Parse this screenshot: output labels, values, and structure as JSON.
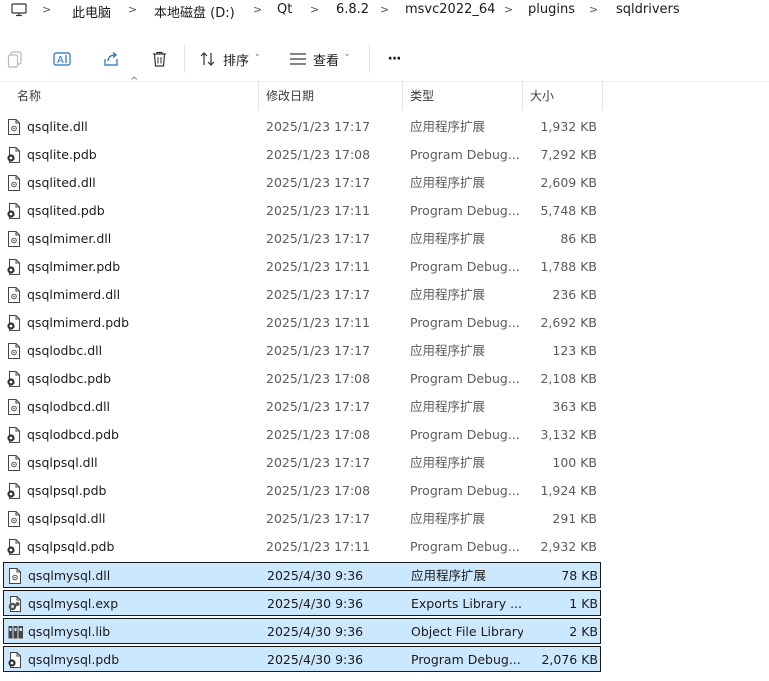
{
  "breadcrumb": [
    "此电脑",
    "本地磁盘 (D:)",
    "Qt",
    "6.8.2",
    "msvc2022_64",
    "plugins",
    "sqldrivers"
  ],
  "toolbar": {
    "sort_label": "排序",
    "view_label": "查看",
    "more_label": "···"
  },
  "columns": {
    "name": "名称",
    "date": "修改日期",
    "type": "类型",
    "size": "大小"
  },
  "files": [
    {
      "name": "qsqlite.dll",
      "date": "2025/1/23 17:17",
      "type": "应用程序扩展",
      "size": "1,932 KB",
      "icon": "dll-file-icon",
      "selected": false
    },
    {
      "name": "qsqlite.pdb",
      "date": "2025/1/23 17:08",
      "type": "Program Debug...",
      "size": "7,292 KB",
      "icon": "pdb-file-icon",
      "selected": false
    },
    {
      "name": "qsqlited.dll",
      "date": "2025/1/23 17:17",
      "type": "应用程序扩展",
      "size": "2,609 KB",
      "icon": "dll-file-icon",
      "selected": false
    },
    {
      "name": "qsqlited.pdb",
      "date": "2025/1/23 17:11",
      "type": "Program Debug...",
      "size": "5,748 KB",
      "icon": "pdb-file-icon",
      "selected": false
    },
    {
      "name": "qsqlmimer.dll",
      "date": "2025/1/23 17:17",
      "type": "应用程序扩展",
      "size": "86 KB",
      "icon": "dll-file-icon",
      "selected": false
    },
    {
      "name": "qsqlmimer.pdb",
      "date": "2025/1/23 17:11",
      "type": "Program Debug...",
      "size": "1,788 KB",
      "icon": "pdb-file-icon",
      "selected": false
    },
    {
      "name": "qsqlmimerd.dll",
      "date": "2025/1/23 17:17",
      "type": "应用程序扩展",
      "size": "236 KB",
      "icon": "dll-file-icon",
      "selected": false
    },
    {
      "name": "qsqlmimerd.pdb",
      "date": "2025/1/23 17:11",
      "type": "Program Debug...",
      "size": "2,692 KB",
      "icon": "pdb-file-icon",
      "selected": false
    },
    {
      "name": "qsqlodbc.dll",
      "date": "2025/1/23 17:17",
      "type": "应用程序扩展",
      "size": "123 KB",
      "icon": "dll-file-icon",
      "selected": false
    },
    {
      "name": "qsqlodbc.pdb",
      "date": "2025/1/23 17:08",
      "type": "Program Debug...",
      "size": "2,108 KB",
      "icon": "pdb-file-icon",
      "selected": false
    },
    {
      "name": "qsqlodbcd.dll",
      "date": "2025/1/23 17:17",
      "type": "应用程序扩展",
      "size": "363 KB",
      "icon": "dll-file-icon",
      "selected": false
    },
    {
      "name": "qsqlodbcd.pdb",
      "date": "2025/1/23 17:08",
      "type": "Program Debug...",
      "size": "3,132 KB",
      "icon": "pdb-file-icon",
      "selected": false
    },
    {
      "name": "qsqlpsql.dll",
      "date": "2025/1/23 17:17",
      "type": "应用程序扩展",
      "size": "100 KB",
      "icon": "dll-file-icon",
      "selected": false
    },
    {
      "name": "qsqlpsql.pdb",
      "date": "2025/1/23 17:08",
      "type": "Program Debug...",
      "size": "1,924 KB",
      "icon": "pdb-file-icon",
      "selected": false
    },
    {
      "name": "qsqlpsqld.dll",
      "date": "2025/1/23 17:17",
      "type": "应用程序扩展",
      "size": "291 KB",
      "icon": "dll-file-icon",
      "selected": false
    },
    {
      "name": "qsqlpsqld.pdb",
      "date": "2025/1/23 17:11",
      "type": "Program Debug...",
      "size": "2,932 KB",
      "icon": "pdb-file-icon",
      "selected": false
    },
    {
      "name": "qsqlmysql.dll",
      "date": "2025/4/30 9:36",
      "type": "应用程序扩展",
      "size": "78 KB",
      "icon": "dll-file-icon",
      "selected": true
    },
    {
      "name": "qsqlmysql.exp",
      "date": "2025/4/30 9:36",
      "type": "Exports Library ...",
      "size": "1 KB",
      "icon": "exp-file-icon",
      "selected": true
    },
    {
      "name": "qsqlmysql.lib",
      "date": "2025/4/30 9:36",
      "type": "Object File Library",
      "size": "2 KB",
      "icon": "lib-file-icon",
      "selected": true
    },
    {
      "name": "qsqlmysql.pdb",
      "date": "2025/4/30 9:36",
      "type": "Program Debug...",
      "size": "2,076 KB",
      "icon": "pdb-file-icon",
      "selected": true
    }
  ]
}
